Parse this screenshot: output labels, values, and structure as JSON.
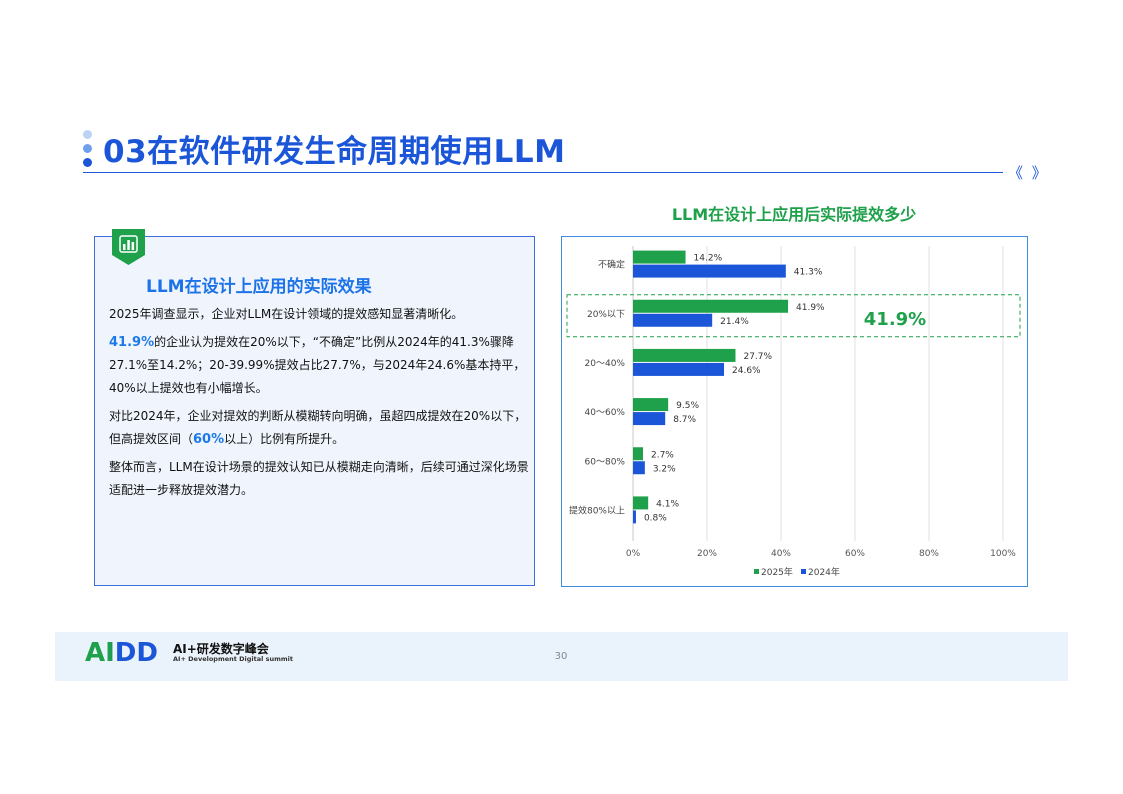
{
  "header": {
    "title": "03在软件研发生命周期使用LLM",
    "chevrons": "《 》"
  },
  "left_panel": {
    "heading": "LLM在设计上应用的实际效果",
    "p1": "2025年调查显示，企业对LLM在设计领域的提效感知显著清晰化。",
    "p2_hl": "41.9%",
    "p2_rest": "的企业认为提效在20%以下，“不确定”比例从2024年的41.3%骤降27.1%至14.2%；20-39.99%提效占比27.7%，与2024年24.6%基本持平，40%以上提效也有小幅增长。",
    "p3_a": "对比2024年，企业对提效的判断从模糊转向明确，虽超四成提效在20%以下，但高提效区间（",
    "p3_hl": "60%",
    "p3_b": "以上）比例有所提升。",
    "p4": "整体而言，LLM在设计场景的提效认知已从模糊走向清晰，后续可通过深化场景适配进一步释放提效潜力。"
  },
  "chart_data": {
    "type": "bar",
    "orientation": "horizontal",
    "title": "LLM在设计上应用后实际提效多少",
    "categories": [
      "不确定",
      "20%以下",
      "20～40%",
      "40～60%",
      "60～80%",
      "提效80%以上"
    ],
    "series": [
      {
        "name": "2025年",
        "values": [
          14.2,
          41.9,
          27.7,
          9.5,
          2.7,
          4.1
        ],
        "labels": [
          "14.2%",
          "41.9%",
          "27.7%",
          "9.5%",
          "2.7%",
          "4.1%"
        ],
        "color": "#1fa04a"
      },
      {
        "name": "2024年",
        "values": [
          41.3,
          21.4,
          24.6,
          8.7,
          3.2,
          0.8
        ],
        "labels": [
          "41.3%",
          "21.4%",
          "24.6%",
          "8.7%",
          "3.2%",
          "0.8%"
        ],
        "color": "#1c56d8"
      }
    ],
    "xlim": [
      0,
      100
    ],
    "xticks": [
      "0%",
      "20%",
      "40%",
      "60%",
      "80%",
      "100%"
    ],
    "grid": true,
    "legend": "bottom",
    "highlight": {
      "category": "20%以下",
      "label": "41.9%",
      "color": "#1fa04a"
    }
  },
  "footer": {
    "logo_text": "AIDD",
    "logo_title": "AI+研发数字峰会",
    "logo_sub": "AI+ Development Digital summit",
    "page_number": "30"
  }
}
